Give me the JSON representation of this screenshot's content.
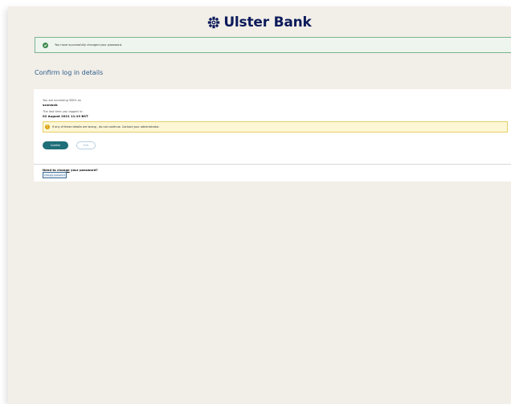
{
  "brand": {
    "name": "Ulster Bank",
    "color": "#0c1b5a"
  },
  "success_banner": {
    "text": "You have successfully changed your password."
  },
  "page_title": "Confirm log in details",
  "details": {
    "accessing_label": "You are accessing SBOL as",
    "user_name": "sxxnwxb",
    "last_login_label": "The last time you logged in:",
    "last_login_value": "02 August 2021 11:19 BST"
  },
  "warning": {
    "text": "If any of these details are wrong , do not continue. Contact your administrator."
  },
  "actions": {
    "confirm_label": "Confirm",
    "exit_label": "Exit"
  },
  "password_change": {
    "question_underlined": "Need to change",
    "question_rest": " your password?",
    "button_label": "Change password"
  },
  "colors": {
    "page_bg": "#f2eee8",
    "success_border": "#79b58c",
    "confirm_button": "#1f6e78",
    "warning_bg": "#fdf7d5"
  }
}
